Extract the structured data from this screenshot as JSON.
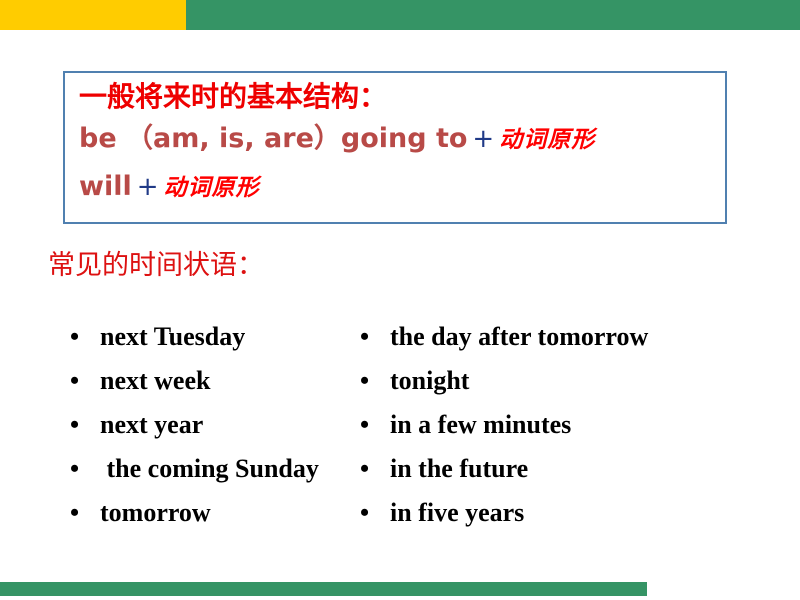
{
  "theme": {
    "band_yellow": "#FFCC00",
    "band_green": "#359465",
    "box_border": "#5080B0",
    "title_red": "#EE0000",
    "english_red": "#B84A47",
    "plus_navy": "#203A87",
    "chinese_red": "#FF0000",
    "heading_red": "#DD1111",
    "bullet_black": "#000000"
  },
  "structure_box": {
    "title": "一般将来时的基本结构：",
    "lines": [
      {
        "english": "be （am, is, are）going to",
        "plus": "+",
        "chinese": "动词原形"
      },
      {
        "english": "will",
        "plus": "+",
        "chinese": "动词原形"
      }
    ]
  },
  "time_adverbials": {
    "heading": "常见的时间状语：",
    "bullet_glyph": "•",
    "left_column": [
      "next Tuesday",
      "next week",
      "next year",
      " the coming Sunday",
      "tomorrow"
    ],
    "right_column": [
      "the day after tomorrow",
      "tonight",
      "in a few minutes",
      "in the future",
      "in five years"
    ]
  }
}
